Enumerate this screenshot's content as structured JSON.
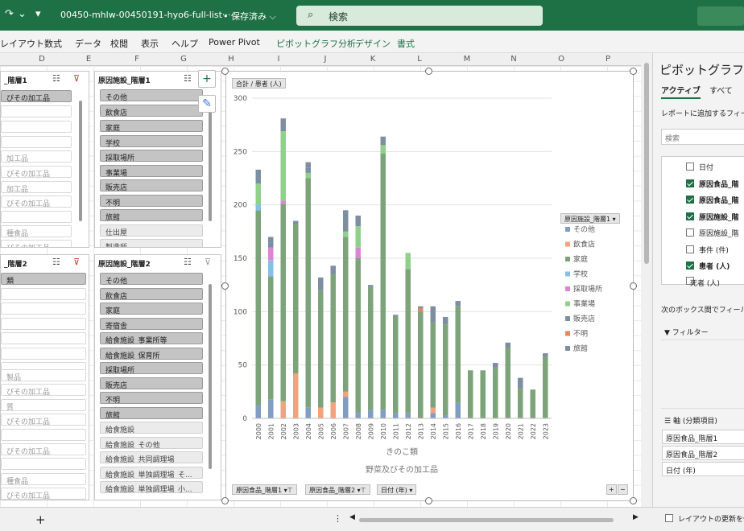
{
  "titlebar": {
    "file_name": "00450-mhlw-00450191-hyo6-full-list···",
    "saved": "• 保存済み ⌵",
    "search_placeholder": "検索"
  },
  "ribbon": {
    "tabs": [
      "レイアウト",
      "数式",
      "データ",
      "校閲",
      "表示",
      "ヘルプ",
      "Power Pivot",
      "ピボットグラフ分析",
      "デザイン",
      "書式"
    ]
  },
  "columns": [
    "D",
    "E",
    "F",
    "G",
    "H",
    "I",
    "J",
    "K",
    "L",
    "M",
    "N",
    "O",
    "P"
  ],
  "slicers": {
    "s1": {
      "title": "_階層1",
      "items": [
        "ぴその加工品",
        "",
        "",
        "",
        "加工品",
        "ぴその加工品",
        "加工品",
        "ぴその加工品",
        "",
        "種食品",
        "ぴその加工品"
      ]
    },
    "s2": {
      "title": "原因施設_階層1",
      "items": [
        "その他",
        "飲食店",
        "家庭",
        "学校",
        "採取場所",
        "事業場",
        "販売店",
        "不明",
        "旅館",
        "仕出屋",
        "製造所"
      ]
    },
    "s3": {
      "title": "_階層2",
      "items": [
        "類",
        "",
        "",
        "",
        "",
        "",
        "",
        "製品",
        "ぴその加工品",
        "質",
        "ぴその加工品",
        "",
        "ぴその加工品",
        "",
        "種食品",
        "ぴその加工品"
      ]
    },
    "s4": {
      "title": "原因施設_階層2",
      "items": [
        "その他",
        "飲食店",
        "家庭",
        "寄宿舎",
        "給食施設_事業所等",
        "給食施設_保育所",
        "採取場所",
        "販売店",
        "不明",
        "旅館",
        "給食施設",
        "給食施設_その他",
        "給食施設_共同調理場",
        "給食施設_単独調理場_そ...",
        "給食施設_単独調理場_小..."
      ]
    }
  },
  "chart_data": {
    "type": "bar",
    "stacked": true,
    "value_field": "合計 / 患者 (人)",
    "categories": [
      "2000",
      "2001",
      "2002",
      "2003",
      "2004",
      "2005",
      "2006",
      "2007",
      "2008",
      "2009",
      "2010",
      "2011",
      "2012",
      "2013",
      "2014",
      "2015",
      "2016",
      "2017",
      "2018",
      "2019",
      "2020",
      "2021",
      "2022",
      "2023"
    ],
    "axis_title_1": "きのこ類",
    "axis_title_2": "野菜及びその加工品",
    "ylim": [
      0,
      300
    ],
    "yticks": [
      0,
      50,
      100,
      150,
      200,
      250,
      300
    ],
    "legend_title": "原因施設_階層1",
    "legend_position": "right",
    "series": [
      {
        "name": "その他",
        "color": "#7f9ec2",
        "values": [
          12,
          18,
          0,
          0,
          10,
          0,
          0,
          20,
          5,
          8,
          8,
          5,
          5,
          0,
          5,
          3,
          15,
          0,
          0,
          0,
          0,
          0,
          0,
          0
        ]
      },
      {
        "name": "飲食店",
        "color": "#f3a27e",
        "values": [
          0,
          0,
          16,
          42,
          0,
          10,
          15,
          5,
          0,
          0,
          0,
          0,
          0,
          0,
          5,
          0,
          0,
          0,
          0,
          0,
          0,
          0,
          0,
          0
        ]
      },
      {
        "name": "家庭",
        "color": "#7da37b",
        "values": [
          183,
          115,
          185,
          140,
          215,
          110,
          120,
          145,
          145,
          115,
          240,
          90,
          135,
          100,
          80,
          85,
          90,
          45,
          45,
          47,
          66,
          28,
          27,
          58
        ]
      },
      {
        "name": "学校",
        "color": "#86c0e8",
        "values": [
          5,
          15,
          0,
          0,
          0,
          0,
          0,
          0,
          0,
          0,
          0,
          0,
          0,
          0,
          0,
          0,
          0,
          0,
          0,
          0,
          0,
          0,
          0,
          0
        ]
      },
      {
        "name": "採取場所",
        "color": "#d987d5",
        "values": [
          0,
          12,
          3,
          0,
          0,
          0,
          0,
          0,
          10,
          0,
          0,
          0,
          0,
          0,
          0,
          0,
          0,
          0,
          0,
          0,
          0,
          0,
          0,
          0
        ]
      },
      {
        "name": "事業場",
        "color": "#8fd18b",
        "values": [
          20,
          0,
          65,
          0,
          5,
          0,
          0,
          5,
          20,
          0,
          8,
          0,
          15,
          0,
          0,
          0,
          0,
          0,
          0,
          0,
          0,
          0,
          0,
          0
        ]
      },
      {
        "name": "販売店",
        "color": "#7b8fa3",
        "values": [
          8,
          5,
          0,
          0,
          5,
          0,
          0,
          0,
          0,
          0,
          0,
          0,
          0,
          0,
          0,
          0,
          0,
          0,
          0,
          0,
          0,
          0,
          0,
          0
        ]
      },
      {
        "name": "不明",
        "color": "#e0895c",
        "values": [
          0,
          0,
          0,
          0,
          0,
          0,
          0,
          0,
          0,
          0,
          0,
          0,
          0,
          3,
          0,
          0,
          0,
          0,
          0,
          0,
          0,
          0,
          0,
          0
        ]
      },
      {
        "name": "旅館",
        "color": "#7e8ea0",
        "values": [
          5,
          5,
          12,
          3,
          5,
          12,
          8,
          20,
          10,
          2,
          8,
          2,
          0,
          2,
          15,
          7,
          5,
          0,
          0,
          5,
          5,
          10,
          0,
          3
        ]
      }
    ],
    "field_buttons": [
      "原因食品_階層1",
      "原因食品_階層2",
      "日付 (年)"
    ]
  },
  "pane": {
    "title": "ピボットグラフの",
    "tab_active": "アクティブ",
    "tab_all": "すべて",
    "hint": "レポートに追加するフィール",
    "search_placeholder": "検索",
    "fields": [
      {
        "label": "日付",
        "checked": false
      },
      {
        "label": "原因食品_階",
        "checked": true
      },
      {
        "label": "原因食品_階",
        "checked": true
      },
      {
        "label": "原因施設_階",
        "checked": true
      },
      {
        "label": "原因施設_階",
        "checked": false
      },
      {
        "label": "事件 (件)",
        "checked": false
      },
      {
        "label": "患者 (人)",
        "checked": true
      },
      {
        "label": "死者 (人)",
        "checked": false
      }
    ],
    "drag_hint": "次のボックス間でフィールド",
    "filter_label": "フィルター",
    "axis_label": "軸 (分類項目)",
    "axis_items": [
      "原因食品_階層1",
      "原因食品_階層2",
      "日付 (年)"
    ],
    "defer_label": "レイアウトの更新を保"
  },
  "status": {
    "add_sheet": "+"
  }
}
